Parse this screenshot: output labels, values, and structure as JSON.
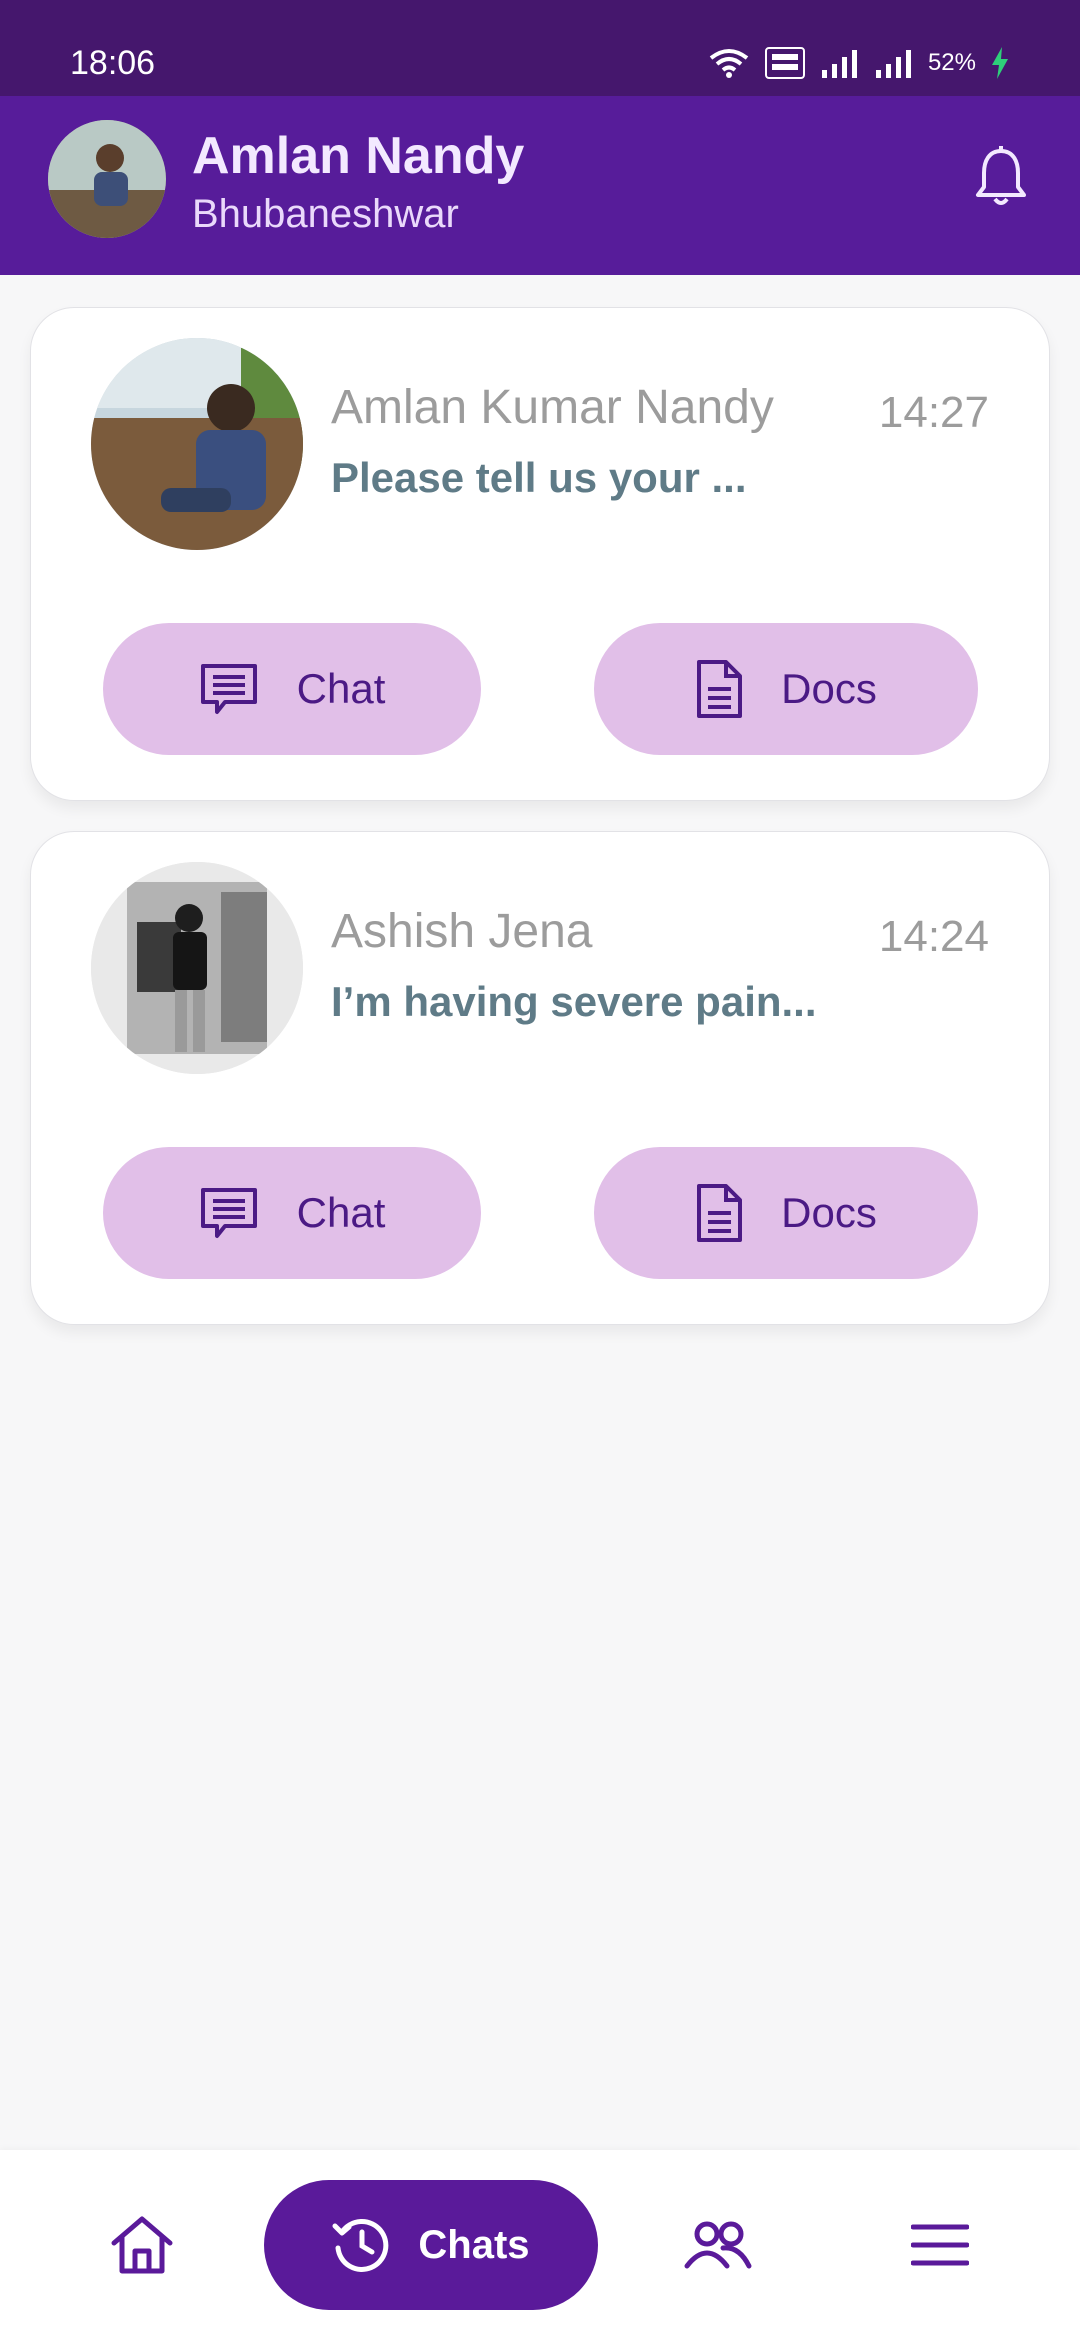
{
  "status_bar": {
    "time": "18:06",
    "battery": "52%",
    "icons": [
      "wifi-icon",
      "volte-icon",
      "signal-icon",
      "signal-icon",
      "charging-icon"
    ]
  },
  "header": {
    "name": "Amlan Nandy",
    "location": "Bhubaneshwar",
    "avatar": "profile-photo",
    "notification_icon": "bell-icon"
  },
  "chats": [
    {
      "name": "Amlan Kumar Nandy",
      "time": "14:27",
      "message": "Please tell us your ...",
      "chat_label": "Chat",
      "docs_label": "Docs"
    },
    {
      "name": "Ashish Jena",
      "time": "14:24",
      "message": "I’m having severe pain...",
      "chat_label": "Chat",
      "docs_label": "Docs"
    }
  ],
  "bottom_nav": {
    "home_icon": "home-icon",
    "chats_label": "Chats",
    "chats_icon": "history-icon",
    "people_icon": "people-icon",
    "menu_icon": "menu-icon"
  },
  "colors": {
    "status_bar": "#45176d",
    "header": "#571c9a",
    "accent": "#5a1a9a",
    "pill": "#e1bfe8",
    "message_text": "#5f7b87"
  }
}
